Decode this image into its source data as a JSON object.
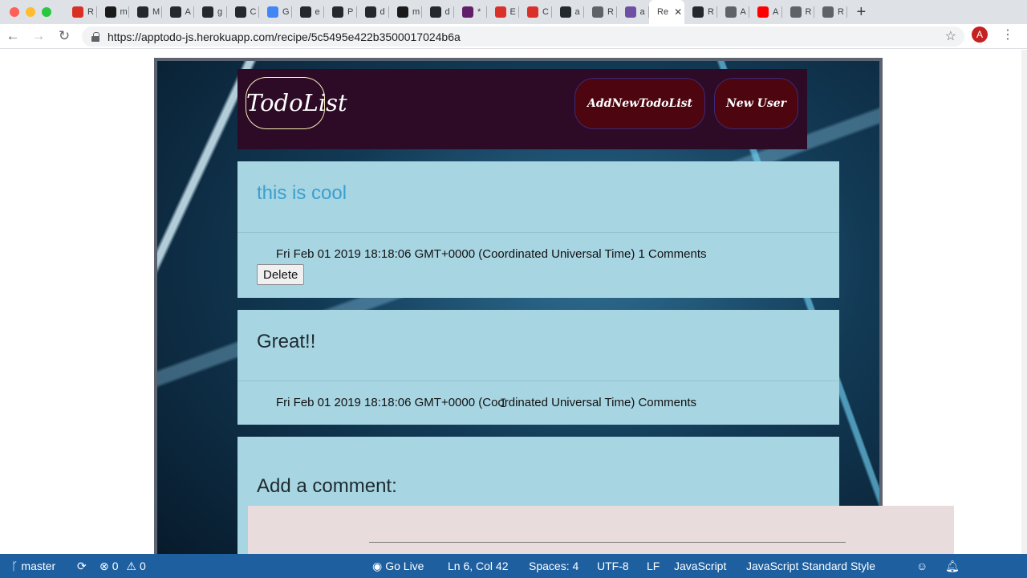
{
  "browser": {
    "tabs": [
      {
        "label": "R",
        "favicon_color": "#d93025"
      },
      {
        "label": "m",
        "favicon_color": "#1a1a1a"
      },
      {
        "label": "M",
        "favicon_color": "#24292e"
      },
      {
        "label": "A",
        "favicon_color": "#24292e"
      },
      {
        "label": "g",
        "favicon_color": "#24292e"
      },
      {
        "label": "C",
        "favicon_color": "#24292e"
      },
      {
        "label": "G",
        "favicon_color": "#4285f4"
      },
      {
        "label": "e",
        "favicon_color": "#24292e"
      },
      {
        "label": "P",
        "favicon_color": "#24292e"
      },
      {
        "label": "d",
        "favicon_color": "#24292e"
      },
      {
        "label": "m",
        "favicon_color": "#1a1a1a"
      },
      {
        "label": "d",
        "favicon_color": "#24292e"
      },
      {
        "label": "*",
        "favicon_color": "#611f69"
      },
      {
        "label": "E",
        "favicon_color": "#d9302a"
      },
      {
        "label": "C",
        "favicon_color": "#d9302a"
      },
      {
        "label": "a",
        "favicon_color": "#24292e"
      },
      {
        "label": "R",
        "favicon_color": "#5f6368"
      },
      {
        "label": "a",
        "favicon_color": "#6e4fa3"
      },
      {
        "label": "Re",
        "favicon_color": "",
        "active": true
      },
      {
        "label": "R",
        "favicon_color": "#24292e"
      },
      {
        "label": "A",
        "favicon_color": "#5f6368"
      },
      {
        "label": "A",
        "favicon_color": "#ff0000"
      },
      {
        "label": "R",
        "favicon_color": "#5f6368"
      },
      {
        "label": "R",
        "favicon_color": "#5f6368"
      }
    ],
    "active_tab_close": "✕",
    "new_tab": "+",
    "url": "https://apptodo-js.herokuapp.com/recipe/5c5495e422b3500017024b6a",
    "profile_initial": "A",
    "back": "←",
    "forward": "→",
    "reload": "↻",
    "bookmark": "☆",
    "menu": "⋮"
  },
  "app": {
    "logo": "TodoList",
    "nav": {
      "add_todo": "AddNewTodoList",
      "new_user": "New User"
    },
    "todos": [
      {
        "title": "this is cool",
        "date": "Fri Feb 01 2019 18:18:06 GMT+0000 (Coordinated Universal Time) 1 Comments",
        "delete_label": "Delete"
      },
      {
        "title": "Great!!",
        "date": "Fri Feb 01 2019 18:18:06 GMT+0000 (Coordinated Universal Time) Comments"
      }
    ],
    "comment_heading": "Add a comment:"
  },
  "statusbar": {
    "branch": "master",
    "errors": "0",
    "warnings": "0",
    "go_live": "Go Live",
    "position": "Ln 6, Col 42",
    "spaces": "Spaces: 4",
    "encoding": "UTF-8",
    "eol": "LF",
    "language": "JavaScript",
    "linter": "JavaScript Standard Style"
  },
  "colors": {
    "statusbar_bg": "#1e5fa0",
    "nav_bg": "#2d0a25",
    "card_bg": "#a8d5e2",
    "title_link": "#3a9fd0"
  }
}
